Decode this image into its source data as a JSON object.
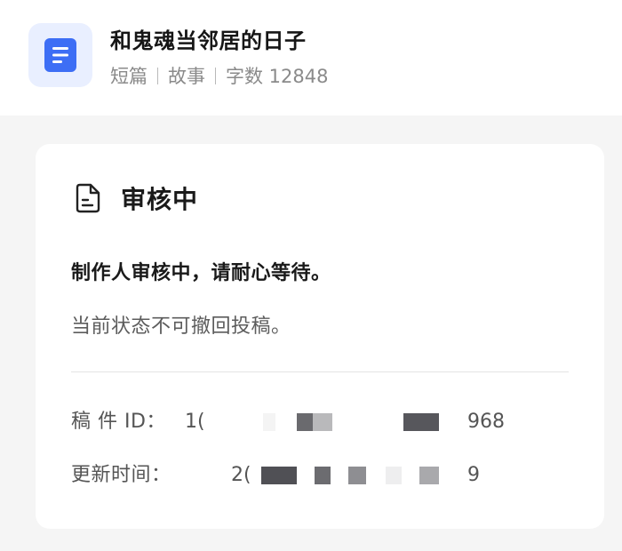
{
  "header": {
    "icon": "document-icon",
    "title": "和鬼魂当邻居的日子",
    "meta": {
      "length_type": "短篇",
      "category": "故事",
      "word_count": "字数 12848"
    }
  },
  "card": {
    "status_icon": "file-text-icon",
    "status_title": "审核中",
    "main_message": "制作人审核中，请耐心等待。",
    "sub_message": "当前状态不可撤回投稿。",
    "manuscript_id": {
      "label": "稿 件 ID：",
      "visible_prefix": "1(",
      "visible_suffix": "968"
    },
    "update_time": {
      "label": "更新时间：",
      "visible_prefix": "2(",
      "visible_suffix": "9"
    }
  },
  "colors": {
    "background": "#f5f5f5",
    "card": "#ffffff",
    "accent": "#3d6ef5",
    "icon_tile": "#e9efff"
  }
}
